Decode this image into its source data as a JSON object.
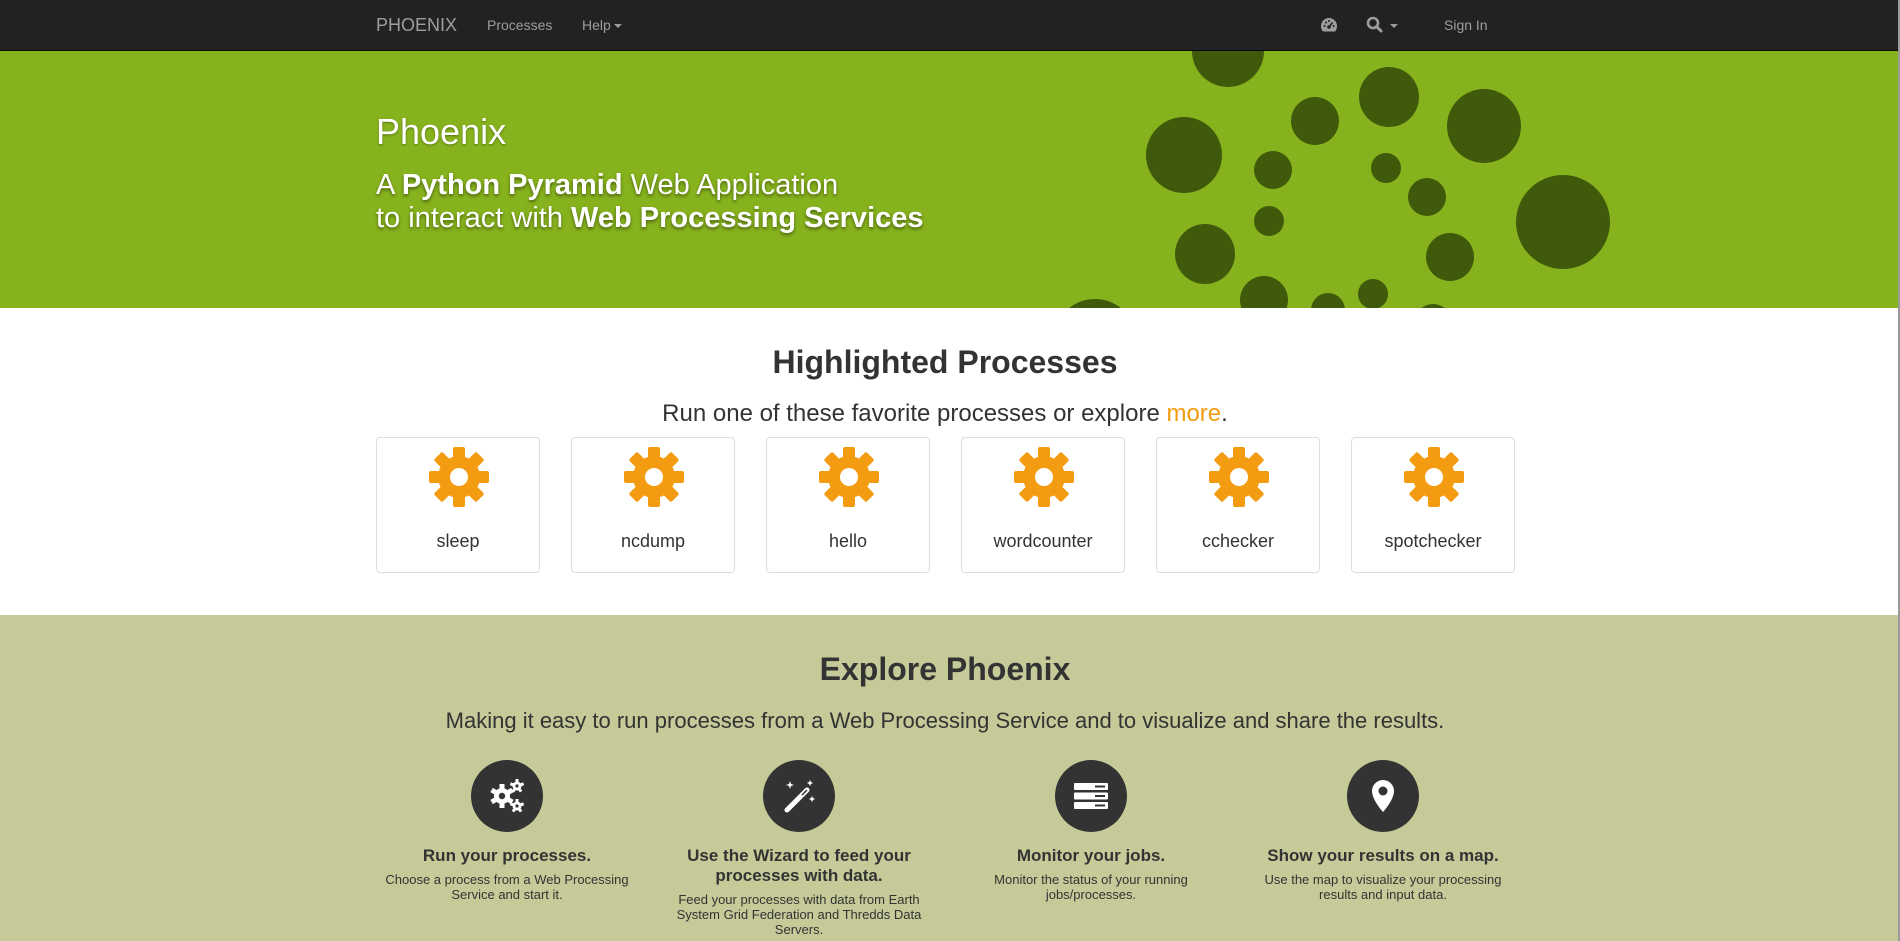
{
  "navbar": {
    "brand": "PHOENIX",
    "processes_link": "Processes",
    "help_link": "Help",
    "dashboard_icon": "dashboard-icon",
    "search_icon": "search-icon",
    "sign_in": "Sign In"
  },
  "hero": {
    "title": "Phoenix",
    "line1_prefix": "A ",
    "line1_bold": "Python Pyramid",
    "line1_suffix": " Web Application",
    "line2_prefix": "to interact with ",
    "line2_bold": "Web Processing Services"
  },
  "highlighted": {
    "title": "Highlighted Processes",
    "lead_prefix": "Run one of these favorite processes or explore ",
    "lead_link": "more",
    "lead_suffix": ".",
    "processes": [
      {
        "label": "sleep",
        "icon": "gear-icon"
      },
      {
        "label": "ncdump",
        "icon": "gear-icon"
      },
      {
        "label": "hello",
        "icon": "gear-icon"
      },
      {
        "label": "wordcounter",
        "icon": "gear-icon"
      },
      {
        "label": "cchecker",
        "icon": "gear-icon"
      },
      {
        "label": "spotchecker",
        "icon": "gear-icon"
      }
    ]
  },
  "explore": {
    "title": "Explore Phoenix",
    "lead": "Making it easy to run processes from a Web Processing Service and to visualize and share the results.",
    "features": [
      {
        "icon": "gears-icon",
        "title": "Run your processes.",
        "text": "Choose a process from a Web Processing Service and start it."
      },
      {
        "icon": "magic-wand-icon",
        "title": "Use the Wizard to feed your processes with data.",
        "text": "Feed your processes with data from Earth System Grid Federation and Thredds Data Servers."
      },
      {
        "icon": "server-icon",
        "title": "Monitor your jobs.",
        "text": "Monitor the status of your running jobs/processes."
      },
      {
        "icon": "map-marker-icon",
        "title": "Show your results on a map.",
        "text": "Use the map to visualize your processing results and input data."
      }
    ]
  },
  "colors": {
    "navbar": "#222222",
    "hero": "#86b21d",
    "hero_dots": "#3f5a0b",
    "accent": "#f39c12",
    "explore_bg": "#c5ca98",
    "feature_circle": "#333333"
  }
}
